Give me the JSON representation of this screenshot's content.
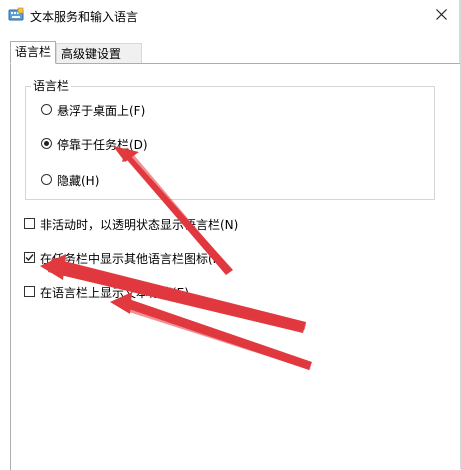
{
  "window": {
    "title": "文本服务和输入语言"
  },
  "tabs": [
    {
      "label": "语言栏",
      "active": true
    },
    {
      "label": "高级键设置",
      "active": false
    }
  ],
  "language_bar_group": {
    "label": "语言栏",
    "options": [
      {
        "label": "悬浮于桌面上(F)",
        "checked": false
      },
      {
        "label": "停靠于任务栏(D)",
        "checked": true
      },
      {
        "label": "隐藏(H)",
        "checked": false
      }
    ]
  },
  "checkboxes": [
    {
      "label": "非活动时，以透明状态显示语言栏(N)",
      "checked": false
    },
    {
      "label": "在任务栏中显示其他语言栏图标(I)",
      "checked": true
    },
    {
      "label": "在语言栏上显示文本标签(E)",
      "checked": false
    }
  ],
  "colors": {
    "annotation_arrow": "#e0393e",
    "border": "#adadad"
  },
  "icons": {
    "title": "keyboard-language-icon",
    "close": "close-icon"
  }
}
